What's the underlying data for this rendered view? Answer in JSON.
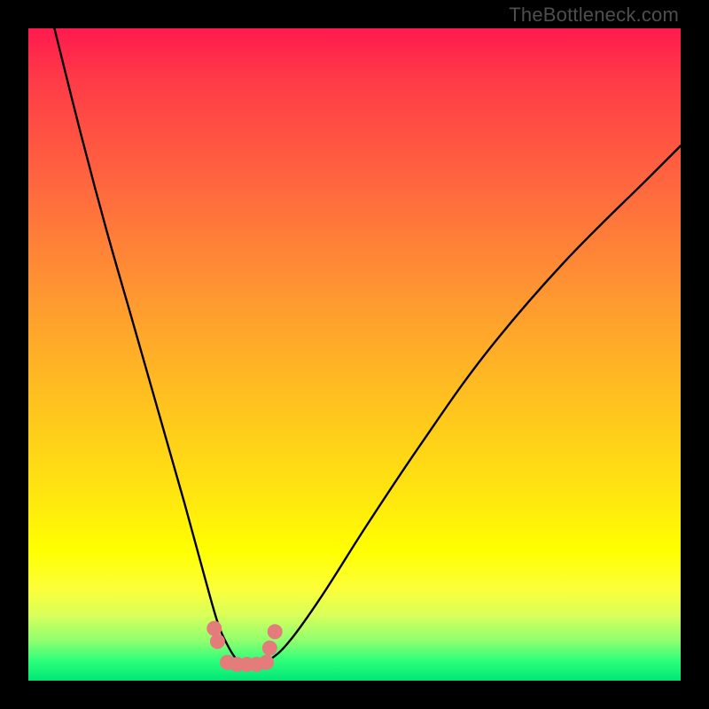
{
  "watermark": "TheBottleneck.com",
  "chart_data": {
    "type": "line",
    "title": "",
    "xlabel": "",
    "ylabel": "",
    "xlim": [
      0,
      100
    ],
    "ylim": [
      0,
      100
    ],
    "series": [
      {
        "name": "bottleneck-curve",
        "x": [
          4,
          8,
          12,
          16,
          20,
          24,
          27,
          29,
          30.5,
          32,
          33.5,
          35,
          37,
          40,
          45,
          52,
          60,
          70,
          82,
          95,
          100
        ],
        "y": [
          100,
          84,
          69,
          55,
          41,
          27,
          16,
          9,
          5.5,
          3.2,
          2.5,
          2.5,
          3.2,
          6,
          13,
          24,
          36,
          50,
          64,
          77,
          82
        ]
      }
    ],
    "markers": {
      "name": "highlight-points",
      "x": [
        28.5,
        29.0,
        30.5,
        32.0,
        33.5,
        35.0,
        36.5,
        37.0,
        37.8
      ],
      "y": [
        8.0,
        6.0,
        2.8,
        2.5,
        2.5,
        2.5,
        2.8,
        5.0,
        7.5
      ]
    },
    "gradient_stops": [
      {
        "pos": 0,
        "color": "#ff1a4e"
      },
      {
        "pos": 25,
        "color": "#ff6a3e"
      },
      {
        "pos": 58,
        "color": "#ffc41e"
      },
      {
        "pos": 80,
        "color": "#ffff00"
      },
      {
        "pos": 97,
        "color": "#2cff7a"
      },
      {
        "pos": 100,
        "color": "#00e676"
      }
    ]
  }
}
